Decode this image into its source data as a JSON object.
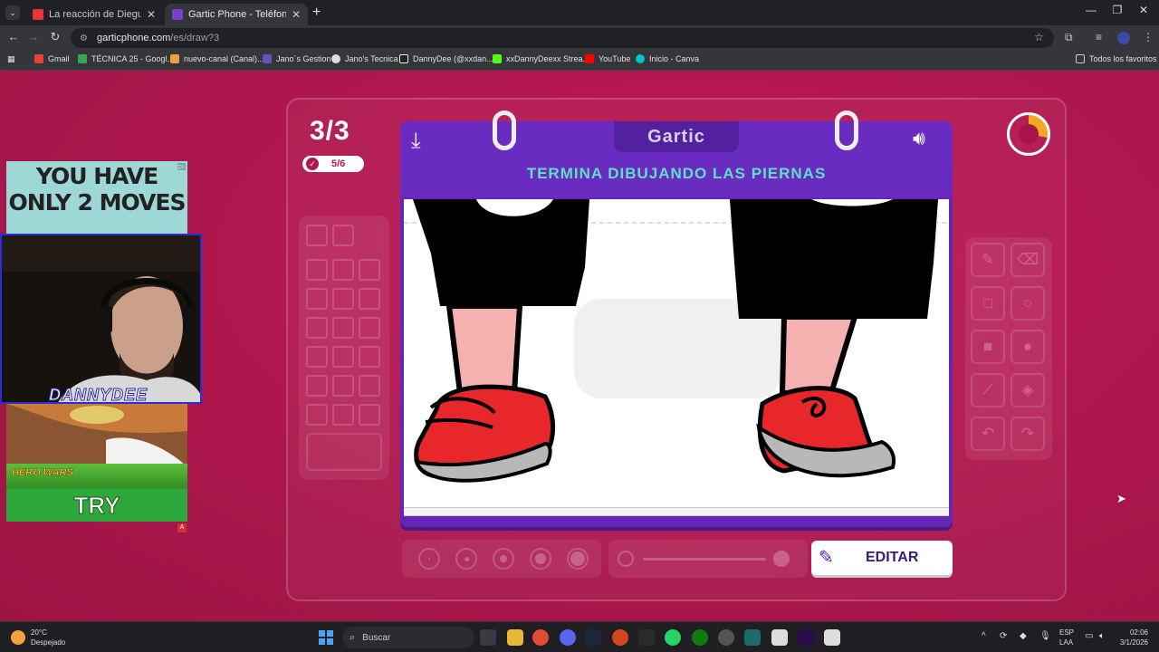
{
  "browser": {
    "tabs": [
      {
        "title": "La reacción de Dieguito Ferna",
        "active": false,
        "favicon_color": "#e53935"
      },
      {
        "title": "Gartic Phone - Teléfono Descon",
        "active": true,
        "favicon_color": "#7b3fd0"
      }
    ],
    "url_host": "garticphone.com",
    "url_path": "/es/draw?3",
    "bookmarks": [
      {
        "label": "Gmail",
        "color": "#ea4335"
      },
      {
        "label": "TÉCNICA 25 - Googl...",
        "color": "#34a853"
      },
      {
        "label": "nuevo-canal (Canal)...",
        "color": "#e8a33a"
      },
      {
        "label": "Jano´s Gestion",
        "color": "#6b4fbb"
      },
      {
        "label": "Jano's Tecnica",
        "color": "#dddddd"
      },
      {
        "label": "DannyDee (@xxdan...",
        "color": "#222222"
      },
      {
        "label": "xxDannyDeexx Strea...",
        "color": "#53fc18"
      },
      {
        "label": "YouTube",
        "color": "#ff0000"
      },
      {
        "label": "Inicio - Canva",
        "color": "#00c4cc"
      }
    ],
    "all_bookmarks": "Todos los favoritos"
  },
  "game": {
    "round": "3/3",
    "progress": "5/6",
    "logo": "Gartic",
    "instruction": "TERMINA DIBUJANDO LAS PIERNAS",
    "edit_label": "EDITAR",
    "timer_fraction_elapsed": 0.28,
    "colors": {
      "accent": "#6a2cc0",
      "instruction": "#5ee0c8",
      "timer": "#f5a623"
    }
  },
  "overlay": {
    "ad_top_text": "YOU HAVE ONLY 2 MOVES",
    "webcam_name": "DANNYDEE",
    "ad_bottom_brand": "HERO WARS",
    "ad_bottom_button": "TRY"
  },
  "taskbar": {
    "weather_temp": "20°C",
    "weather_desc": "Despejado",
    "search_placeholder": "Buscar",
    "lang_1": "ESP",
    "lang_2": "LAA",
    "time": "02:06",
    "date": "3/1/2026"
  }
}
